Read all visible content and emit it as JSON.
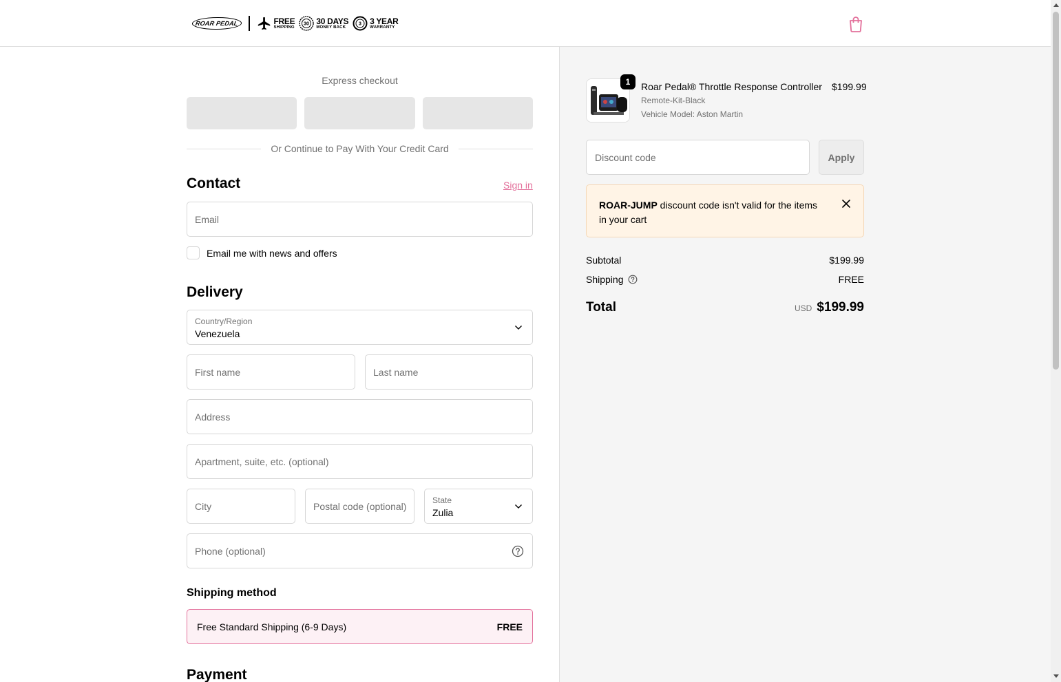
{
  "header": {
    "brand": "ROAR PEDAL",
    "badges": [
      {
        "icon": "airplane-icon",
        "line1": "FREE",
        "line2": "SHIPPING"
      },
      {
        "icon": "money-back-seal-icon",
        "seal": "30",
        "line1": "30 DAYS",
        "line2": "MONEY BACK"
      },
      {
        "icon": "warranty-seal-icon",
        "seal": "3",
        "line1": "3 YEAR",
        "line2": "WARRANTY"
      }
    ],
    "cart_icon": "shopping-bag-icon",
    "accent_color": "#e3709b"
  },
  "express": {
    "title": "Express checkout",
    "divider_text": "Or Continue to Pay With Your Credit Card"
  },
  "contact": {
    "heading": "Contact",
    "signin": "Sign in",
    "email_placeholder": "Email",
    "newsletter_label": "Email me with news and offers"
  },
  "delivery": {
    "heading": "Delivery",
    "country_label": "Country/Region",
    "country_value": "Venezuela",
    "first_name": "First name",
    "last_name": "Last name",
    "address": "Address",
    "apartment": "Apartment, suite, etc. (optional)",
    "city": "City",
    "postal": "Postal code (optional)",
    "state_label": "State",
    "state_value": "Zulia",
    "phone": "Phone (optional)"
  },
  "shipping": {
    "heading": "Shipping method",
    "option_label": "Free Standard Shipping (6-9 Days)",
    "option_price": "FREE"
  },
  "payment": {
    "heading": "Payment"
  },
  "order": {
    "quantity": "1",
    "product_name": "Roar Pedal® Throttle Response Controller",
    "variant": "Remote-Kit-Black",
    "vehicle_model": "Vehicle Model: Aston Martin",
    "price": "$199.99",
    "discount_placeholder": "Discount code",
    "apply_label": "Apply",
    "alert_code": "ROAR-JUMP",
    "alert_text": " discount code isn't valid for the items in your cart",
    "subtotal_label": "Subtotal",
    "subtotal_value": "$199.99",
    "shipping_label": "Shipping",
    "shipping_value": "FREE",
    "total_label": "Total",
    "total_currency": "USD",
    "total_value": "$199.99"
  }
}
